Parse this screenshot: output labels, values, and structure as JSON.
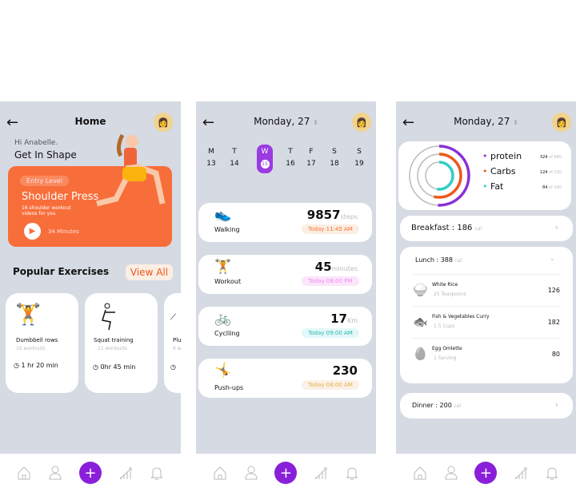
{
  "home": {
    "title": "Home",
    "greeting": "Hi Anabelle.",
    "subtitle": "Get In Shape",
    "featured": {
      "level": "Entry Level",
      "title": "Shoulder Press",
      "description": "16 shoulder workout videos for you",
      "duration": "34 Minutes",
      "color": "#f86e3a"
    },
    "section_title": "Popular Exercises",
    "view_all": "View All",
    "exercises": [
      {
        "name": "Dumbbell rows",
        "count": "16 workouts",
        "time": "1 hr 20 min",
        "icon": "dumbbell-icon"
      },
      {
        "name": "Squat training",
        "count": "11 workouts",
        "time": "0hr 45 min",
        "icon": "squat-icon"
      },
      {
        "name": "Plu",
        "count": "6 w",
        "time": "",
        "icon": "plank-icon"
      }
    ]
  },
  "activity": {
    "date": "Monday, 27",
    "days": [
      {
        "d": "M",
        "n": "13"
      },
      {
        "d": "T",
        "n": "14"
      },
      {
        "d": "W",
        "n": "15",
        "selected": true
      },
      {
        "d": "T",
        "n": "16"
      },
      {
        "d": "F",
        "n": "17"
      },
      {
        "d": "S",
        "n": "18"
      },
      {
        "d": "S",
        "n": "19"
      }
    ],
    "items": [
      {
        "label": "Walking",
        "value": "9857",
        "unit": "steps",
        "time": "Today 11:45 AM",
        "color": "#f8722e",
        "bg": "#fbeee3",
        "icon": "shoe-icon"
      },
      {
        "label": "Workout",
        "value": "45",
        "unit": "minutes",
        "time": "Today 08:00 PM",
        "color": "#f28bf0",
        "bg": "#fbe6fb",
        "icon": "dumbbell-icon"
      },
      {
        "label": "Cyclling",
        "value": "17",
        "unit": "Km",
        "time": "Today 09:00 AM",
        "color": "#2bb8a8",
        "bg": "#e3f8fa",
        "icon": "bicycle-icon"
      },
      {
        "label": "Push-ups",
        "value": "230",
        "unit": "",
        "time": "Today 08:00 AM",
        "color": "#e3b04d",
        "bg": "#fbf1e6",
        "icon": "pushup-icon"
      }
    ]
  },
  "nutrition": {
    "date": "Monday, 27",
    "macros": [
      {
        "name": "protein",
        "value": 324,
        "total": 640,
        "of": "of",
        "color": "#8a2fd8"
      },
      {
        "name": "Carbs",
        "value": 124,
        "total": 230,
        "of": "of",
        "color": "#f0571b"
      },
      {
        "name": "Fat",
        "value": 84,
        "total": 160,
        "of": "of",
        "color": "#2fd0c4"
      }
    ],
    "breakfast": {
      "label": "Breakfast : 186",
      "unit": "cal"
    },
    "lunch": {
      "label": "Lunch : 388",
      "unit": "cal",
      "foods": [
        {
          "name": "White Rice",
          "qty": "25 Teaspoons",
          "cal": "126",
          "icon": "rice-bowl-icon"
        },
        {
          "name": "Fish & Vegetables Curry",
          "qty": "1.5 Cups",
          "cal": "182",
          "icon": "fish-icon"
        },
        {
          "name": "Egg Omlette",
          "qty": "1 Serving",
          "cal": "80",
          "icon": "egg-icon"
        }
      ]
    },
    "dinner": {
      "label": "Dinner : 200",
      "unit": "cal"
    }
  },
  "nav": {
    "plus": "+"
  }
}
